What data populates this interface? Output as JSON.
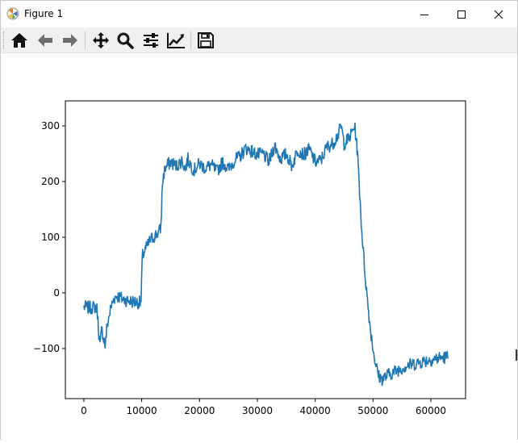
{
  "window": {
    "title": "Figure 1",
    "app_icon": "matplotlib-icon",
    "controls": [
      "minimize-icon",
      "maximize-icon",
      "close-icon"
    ]
  },
  "toolbar": {
    "buttons": [
      {
        "name": "home-button",
        "icon": "home-icon"
      },
      {
        "name": "back-button",
        "icon": "arrow-left-icon"
      },
      {
        "name": "forward-button",
        "icon": "arrow-right-icon"
      },
      {
        "name": "pan-button",
        "icon": "move-icon"
      },
      {
        "name": "zoom-button",
        "icon": "magnifier-icon"
      },
      {
        "name": "subplots-button",
        "icon": "sliders-icon"
      },
      {
        "name": "edit-axes-button",
        "icon": "line-chart-icon"
      },
      {
        "name": "save-button",
        "icon": "floppy-disk-icon"
      }
    ]
  },
  "chart_data": {
    "type": "line",
    "title": "",
    "xlabel": "",
    "ylabel": "",
    "xlim": [
      -3200,
      66000
    ],
    "ylim": [
      -190,
      345
    ],
    "xticks": [
      0,
      10000,
      20000,
      30000,
      40000,
      50000,
      60000
    ],
    "yticks": [
      -100,
      0,
      100,
      200,
      300
    ],
    "xtick_labels": [
      "0",
      "10000",
      "20000",
      "30000",
      "40000",
      "50000",
      "60000"
    ],
    "ytick_labels": [
      "−100",
      "0",
      "100",
      "200",
      "300"
    ],
    "grid": false,
    "legend": "none",
    "line_color": "#1f77b4",
    "noise_amplitude": 12,
    "series": [
      {
        "x": [
          0,
          1000,
          2000,
          2300,
          2500,
          2800,
          3100,
          3400,
          3700,
          4000,
          4300,
          4700,
          5200,
          5700,
          6200,
          7000,
          8000,
          9000,
          9900,
          10100,
          10500,
          11000,
          11500,
          12000,
          12800,
          13300,
          13600,
          14000,
          14500,
          15000,
          16000,
          17000,
          17500,
          18000,
          19000,
          20000,
          21000,
          22000,
          23000,
          24000,
          25000,
          26000,
          27000,
          28000,
          29000,
          30000,
          31000,
          32000,
          33000,
          34000,
          35000,
          36000,
          37000,
          38000,
          39000,
          40000,
          41000,
          42000,
          43000,
          44000,
          44500,
          45000,
          46000,
          46800,
          47200,
          47600,
          48000,
          48500,
          49000,
          49500,
          50000,
          50500,
          51000,
          51500,
          52000,
          52500,
          53000,
          54000,
          55000,
          56000,
          57000,
          58000,
          59000,
          60000,
          61000,
          62000,
          63000
        ],
        "y": [
          -25,
          -27,
          -25,
          -30,
          -60,
          -95,
          -65,
          -80,
          -95,
          -60,
          -45,
          -25,
          -10,
          -5,
          -8,
          -12,
          -15,
          -16,
          -18,
          65,
          75,
          85,
          95,
          100,
          108,
          115,
          200,
          222,
          230,
          235,
          228,
          238,
          222,
          240,
          220,
          232,
          224,
          230,
          218,
          235,
          222,
          238,
          245,
          260,
          255,
          248,
          250,
          235,
          265,
          240,
          250,
          228,
          258,
          248,
          258,
          235,
          238,
          262,
          268,
          285,
          300,
          268,
          280,
          300,
          268,
          200,
          120,
          50,
          -10,
          -60,
          -100,
          -130,
          -150,
          -155,
          -152,
          -148,
          -145,
          -140,
          -135,
          -130,
          -128,
          -125,
          -122,
          -120,
          -118,
          -116,
          -115
        ]
      }
    ]
  }
}
